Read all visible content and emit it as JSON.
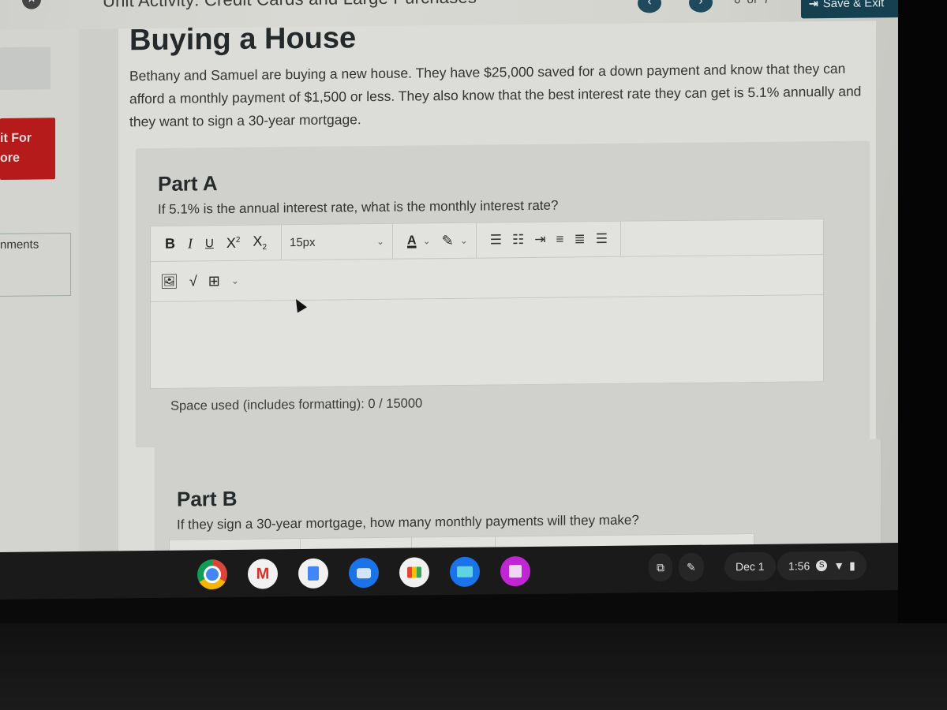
{
  "header": {
    "unit_title": "Unit Activity: Credit Cards and Large Purchases",
    "page_indicator": "6  of  7",
    "save_exit_label": "Save & Exit",
    "prev_icon": "chevron-left-icon",
    "next_icon": "chevron-right-icon",
    "close_icon": "close-icon"
  },
  "sidebar": {
    "submit_label_line1": "it For",
    "submit_label_line2": "ore",
    "comments_label": "nments"
  },
  "page": {
    "title": "Buying a House",
    "intro": "Bethany and Samuel are buying a new house. They have $25,000 saved for a down payment and know that they can afford a monthly payment of $1,500 or less. They also know that the best interest rate they can get is 5.1% annually and they want to sign a 30-year mortgage."
  },
  "partA": {
    "title": "Part A",
    "question": "If 5.1% is the annual interest rate, what is the monthly interest rate?",
    "editor_value": "",
    "space_used": "Space used (includes formatting): 0 / 15000"
  },
  "partB": {
    "title": "Part B",
    "question": "If they sign a 30-year mortgage, how many monthly payments will they make?"
  },
  "toolbar": {
    "bold": "B",
    "italic": "I",
    "underline": "U",
    "superscript": "X",
    "superscript_mark": "2",
    "subscript": "X",
    "subscript_mark": "2",
    "font_size": "15px",
    "text_color": "A",
    "chevron": "⌄"
  },
  "shelf": {
    "apps": [
      "Chrome",
      "Gmail",
      "Docs",
      "Messages",
      "Meet",
      "Files",
      "Canvas"
    ],
    "date": "Dec 1",
    "time": "1:56",
    "account_badge": "S"
  },
  "colors": {
    "save_exit_bg": "#14404f",
    "nav_btn_bg": "#1f4a5e",
    "submit_bg": "#b51b1b"
  }
}
